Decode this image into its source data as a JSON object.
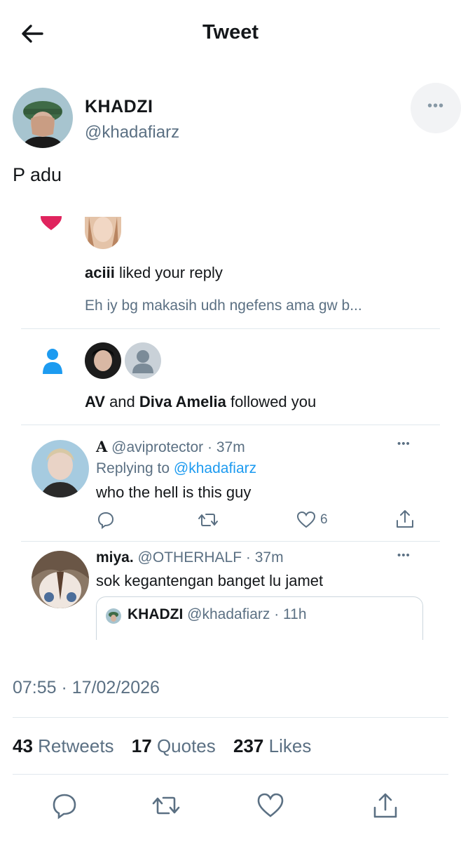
{
  "header": {
    "title": "Tweet"
  },
  "tweet": {
    "author_name": "KHADZI",
    "author_handle": "@khadafiarz",
    "text": "P adu",
    "timestamp": "07:55 · 17/02/2026",
    "stats": {
      "retweets_count": "43",
      "retweets_label": "Retweets",
      "quotes_count": "17",
      "quotes_label": "Quotes",
      "likes_count": "237",
      "likes_label": "Likes"
    }
  },
  "embedded": {
    "notif_like": {
      "user": "aciii",
      "action": "liked your reply",
      "preview": "Eh iy bg makasih udh ngefens ama gw b..."
    },
    "notif_follow": {
      "user1": "AV",
      "conj": "and",
      "user2": "Diva Amelia",
      "action": "followed you"
    },
    "reply1": {
      "name": "A",
      "handle": "@aviprotector",
      "time": "· 37m",
      "replying_prefix": "Replying to",
      "replying_handle": "@khadafiarz",
      "text": "who the hell is this guy",
      "like_count": "6"
    },
    "reply2": {
      "name": "miya.",
      "handle": "@OTHERHALF",
      "time": "· 37m",
      "text": "sok kegantengan banget lu jamet",
      "quote_name": "KHADZI",
      "quote_handle": "@khadafiarz",
      "quote_time": "· 11h"
    }
  },
  "colors": {
    "accent": "#1d9bf0",
    "heart": "#e0245e",
    "follow": "#1d9bf0",
    "muted": "#5b7083"
  }
}
